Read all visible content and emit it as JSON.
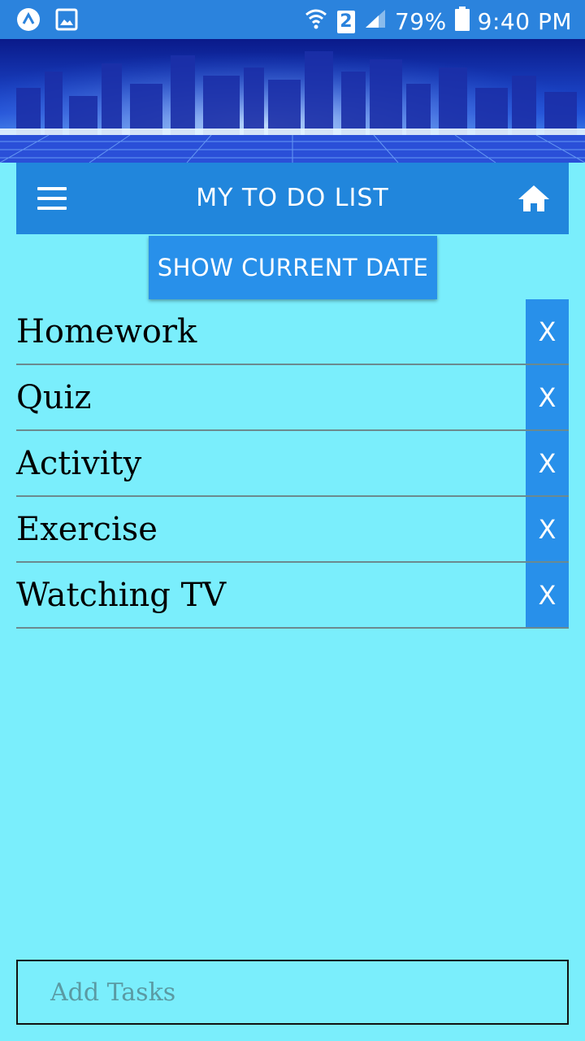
{
  "status_bar": {
    "battery": "79%",
    "time": "9:40 PM",
    "sim_slot": "2",
    "icons": [
      "app-icon",
      "gallery-icon",
      "wifi-icon",
      "sim-icon",
      "signal-icon",
      "battery-icon"
    ]
  },
  "toolbar": {
    "title": "MY TO DO LIST",
    "menu_icon": "hamburger-menu-icon",
    "home_icon": "home-icon"
  },
  "date_button": {
    "label": "SHOW CURRENT DATE"
  },
  "tasks": [
    {
      "label": "Homework",
      "delete_label": "X"
    },
    {
      "label": "Quiz",
      "delete_label": "X"
    },
    {
      "label": "Activity",
      "delete_label": "X"
    },
    {
      "label": "Exercise",
      "delete_label": "X"
    },
    {
      "label": "Watching TV",
      "delete_label": "X"
    }
  ],
  "add_task": {
    "placeholder": "Add Tasks",
    "value": ""
  },
  "colors": {
    "background": "#7aeefc",
    "status_bar": "#2b83dd",
    "toolbar": "#2186dc",
    "button": "#2890ea"
  }
}
